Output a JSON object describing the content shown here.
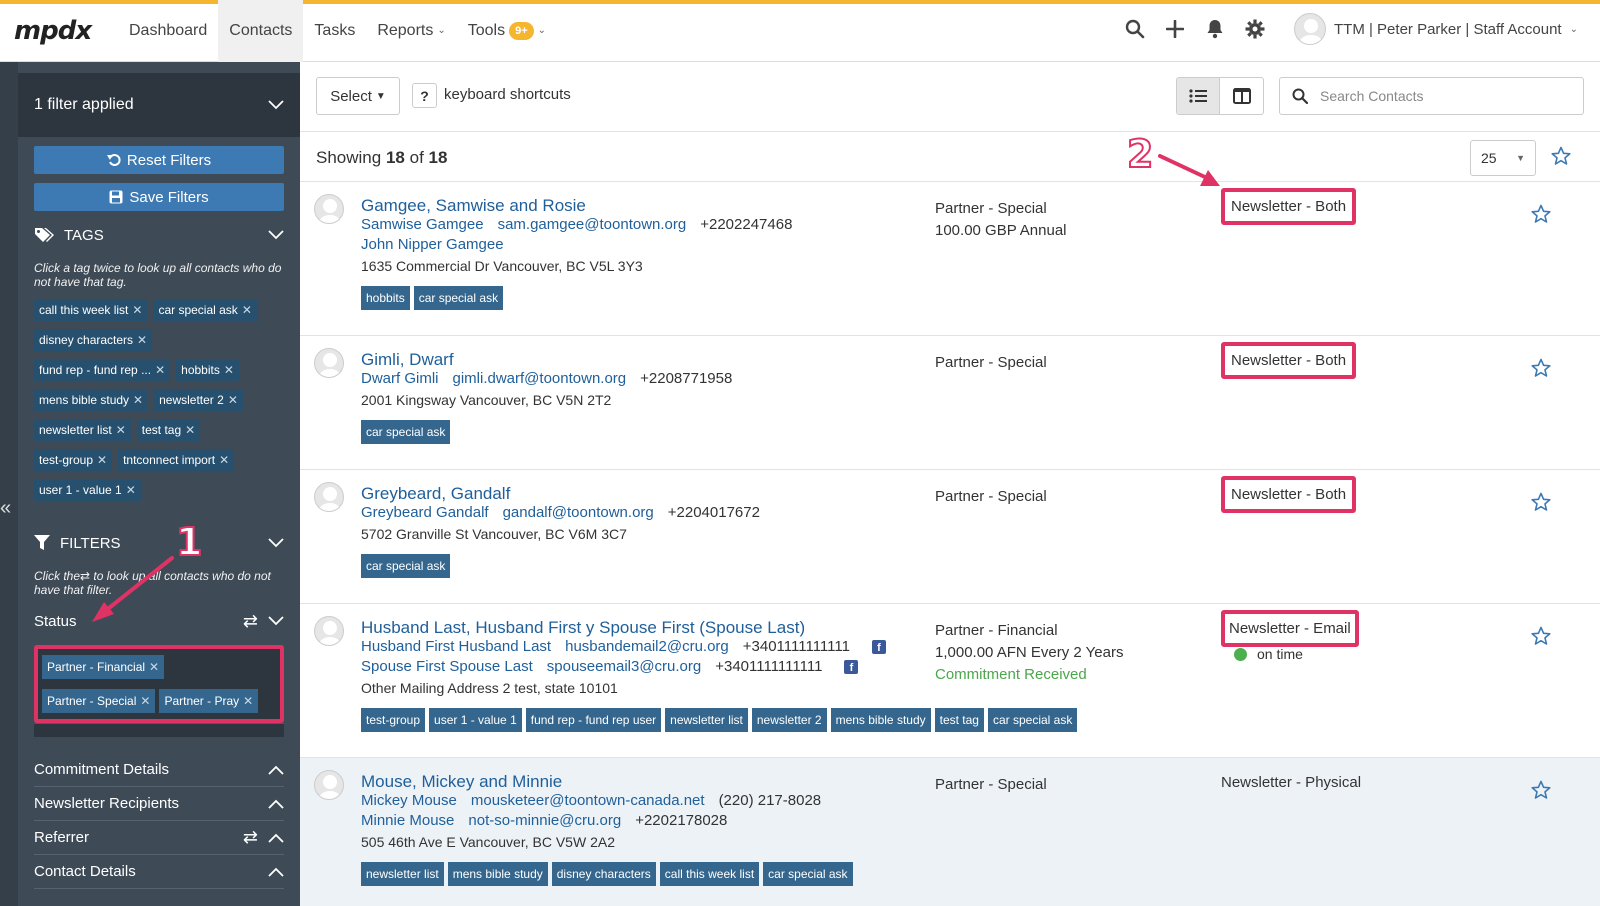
{
  "app": {
    "logo_text": "mpdx",
    "nav": [
      "Dashboard",
      "Contacts",
      "Tasks",
      "Reports",
      "Tools"
    ],
    "tools_badge": "9+",
    "account": "TTM | Peter Parker | Staff Account",
    "accent_color": "#f5b52e"
  },
  "sidebar": {
    "filter_heading": "1 filter applied",
    "reset_label": "Reset Filters",
    "save_label": "Save Filters",
    "tags_heading": "TAGS",
    "tags_hint": "Click a tag twice to look up all contacts who do not have that tag.",
    "tags": [
      "call this week list",
      "car special ask",
      "disney characters",
      "fund rep - fund rep ...",
      "hobbits",
      "mens bible study",
      "newsletter 2",
      "newsletter list",
      "test tag",
      "test-group",
      "tntconnect import",
      "user 1 - value 1"
    ],
    "filters_heading": "FILTERS",
    "filters_hint_a": "Click the",
    "filters_hint_b": "to look up all contacts who do not have that filter.",
    "status_label": "Status",
    "status_values": [
      "Partner - Financial",
      "Partner - Special",
      "Partner - Pray"
    ],
    "accordion": [
      "Commitment Details",
      "Newsletter Recipients",
      "Referrer",
      "Contact Details"
    ]
  },
  "toolbar": {
    "select_label": "Select",
    "kbd_key": "?",
    "kbd_label": "keyboard shortcuts",
    "search_placeholder": "Search Contacts"
  },
  "listing": {
    "showing_prefix": "Showing",
    "shown": "18",
    "of": "of",
    "total": "18",
    "per_page": "25"
  },
  "contacts": [
    {
      "name": "Gamgee, Samwise and Rosie",
      "person1": "Samwise Gamgee",
      "email1": "sam.gamgee@toontown.org",
      "phone1": "+2202247468",
      "person2": "John Nipper Gamgee",
      "address": "1635 Commercial Dr Vancouver, BC V5L 3Y3",
      "tags": [
        "hobbits",
        "car special ask"
      ],
      "status": "Partner - Special",
      "pledge": "100.00 GBP Annual",
      "newsletter": "Newsletter - Both"
    },
    {
      "name": "Gimli, Dwarf",
      "person1": "Dwarf Gimli",
      "email1": "gimli.dwarf@toontown.org",
      "phone1": "+2208771958",
      "address": "2001 Kingsway Vancouver, BC V5N 2T2",
      "tags": [
        "car special ask"
      ],
      "status": "Partner - Special",
      "newsletter": "Newsletter - Both"
    },
    {
      "name": "Greybeard, Gandalf",
      "person1": "Greybeard Gandalf",
      "email1": "gandalf@toontown.org",
      "phone1": "+2204017672",
      "address": "5702 Granville St Vancouver, BC V6M 3C7",
      "tags": [
        "car special ask"
      ],
      "status": "Partner - Special",
      "newsletter": "Newsletter - Both"
    },
    {
      "name": "Husband Last, Husband First y Spouse First (Spouse Last)",
      "person1": "Husband First Husband Last",
      "email1": "husbandemail2@cru.org",
      "phone1": "+3401111111111",
      "person2": "Spouse First Spouse Last",
      "email2": "spouseemail3@cru.org",
      "phone2": "+3401111111111",
      "address": "Other Mailing Address 2 test, state 10101",
      "tags": [
        "test-group",
        "user 1 - value 1",
        "fund rep - fund rep user",
        "newsletter list",
        "newsletter 2",
        "mens bible study",
        "test tag",
        "car special ask"
      ],
      "status": "Partner - Financial",
      "pledge": "1,000.00 AFN Every 2 Years",
      "pledge_note": "Commitment Received",
      "newsletter": "Newsletter - Email",
      "late_status": "on time"
    },
    {
      "name": "Mouse, Mickey and Minnie",
      "person1": "Mickey Mouse",
      "email1": "mousketeer@toontown-canada.net",
      "phone1": "(220) 217-8028",
      "person2": "Minnie Mouse",
      "email2": "not-so-minnie@cru.org",
      "phone2": "+2202178028",
      "address": "505 46th Ave E Vancouver, BC V5W 2A2",
      "tags": [
        "newsletter list",
        "mens bible study",
        "disney characters",
        "call this week list",
        "car special ask"
      ],
      "status": "Partner - Special",
      "newsletter": "Newsletter - Physical"
    }
  ],
  "annotations": [
    "1",
    "2"
  ],
  "highlight_color": "#e03365"
}
